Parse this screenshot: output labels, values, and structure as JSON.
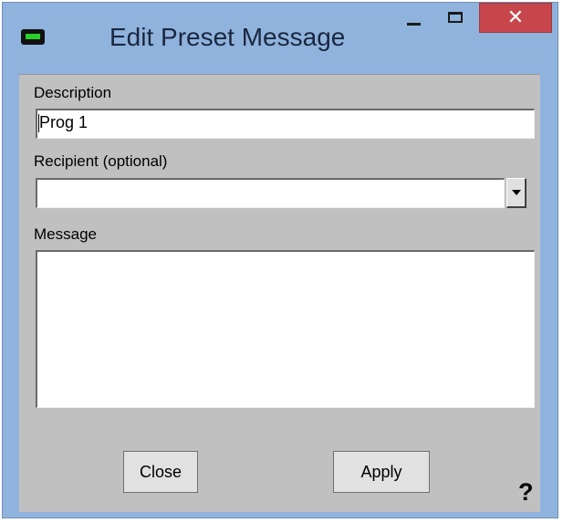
{
  "window": {
    "title": "Edit Preset Message",
    "icon": "terminal-device-icon",
    "controls": {
      "minimize_icon": "minimize-icon",
      "maximize_icon": "maximize-icon",
      "close_glyph": "✕",
      "close_color": "#c7464b"
    }
  },
  "form": {
    "description": {
      "label": "Description",
      "value": "Prog 1"
    },
    "recipient": {
      "label": "Recipient (optional)",
      "value": "",
      "dropdown_icon": "chevron-down-icon"
    },
    "message": {
      "label": "Message",
      "value": ""
    }
  },
  "buttons": {
    "close_label": "Close",
    "apply_label": "Apply"
  },
  "help": {
    "glyph": "?"
  }
}
